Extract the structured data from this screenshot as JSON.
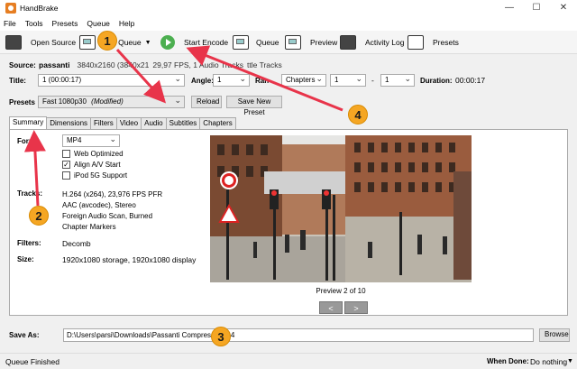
{
  "window": {
    "title": "HandBrake",
    "min": "—",
    "max": "☐",
    "close": "✕"
  },
  "menu": [
    "File",
    "Tools",
    "Presets",
    "Queue",
    "Help"
  ],
  "toolbar": {
    "open_source": "Open Source",
    "add_queue": "o Queue",
    "start_encode": "Start Encode",
    "queue": "Queue",
    "preview": "Preview",
    "activity_log": "Activity Log",
    "presets": "Presets"
  },
  "source": {
    "label": "Source:",
    "name": "passanti",
    "info": "3840x2160 (3840x21",
    "info2": "29,97 FPS, 1 Audio Tracks",
    "info3": "ttle Tracks"
  },
  "title_row": {
    "title_label": "Title:",
    "title_value": "1 (00:00:17)",
    "angle_label": "Angle:",
    "angle_value": "1",
    "range_label": "Ran",
    "range_type": "Chapters",
    "range_from": "1",
    "range_sep": "-",
    "range_to": "1",
    "duration_label": "Duration:",
    "duration_value": "00:00:17"
  },
  "presets": {
    "label": "Presets",
    "value": "Fast 1080p30",
    "modified": "(Modified)",
    "reload": "Reload",
    "save_new": "Save New Preset"
  },
  "tabs": [
    "Summary",
    "Dimensions",
    "Filters",
    "Video",
    "Audio",
    "Subtitles",
    "Chapters"
  ],
  "summary": {
    "format_label": "Form",
    "format_value": "MP4",
    "web_optimized": "Web Optimized",
    "align_av": "Align A/V Start",
    "ipod": "iPod 5G Support",
    "tracks_label": "Tracks:",
    "tracks": [
      "H.264 (x264), 23,976 FPS PFR",
      "AAC (avcodec), Stereo",
      "Foreign Audio Scan, Burned",
      "Chapter Markers"
    ],
    "filters_label": "Filters:",
    "filters_value": "Decomb",
    "size_label": "Size:",
    "size_value": "1920x1080 storage, 1920x1080 display",
    "preview_caption": "Preview 2 of 10",
    "prev": "<",
    "next": ">"
  },
  "save_as": {
    "label": "Save As:",
    "path": "D:\\Users\\parsi\\Downloads\\Passanti Compresso.mp4",
    "browse": "Browse"
  },
  "status": {
    "text": "Queue Finished",
    "when_done_label": "When Done:",
    "when_done_value": "Do nothing"
  },
  "callouts": [
    "1",
    "2",
    "3",
    "4"
  ],
  "colors": {
    "callout": "#f5a623",
    "arrow": "#e8344a",
    "play": "#4caf50"
  }
}
